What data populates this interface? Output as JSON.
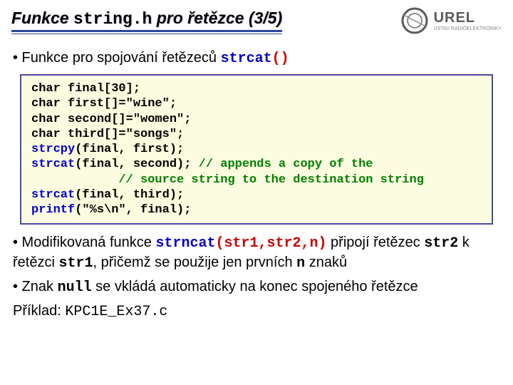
{
  "header": {
    "title_pre": "Funkce ",
    "title_mono": "string.h",
    "title_post": " pro řetězce (3/5)",
    "logo_main": "UREL",
    "logo_sub": "ÚSTAV RADIOELEKTRONIKY"
  },
  "bullet1": {
    "pre": "• Funkce pro spojování řetězeců ",
    "fn": "strcat",
    "paren": "()"
  },
  "code": {
    "l1": "char final[30];",
    "l2": "char first[]=\"wine\";",
    "l3": "char second[]=\"women\";",
    "l4": "char third[]=\"songs\";",
    "l5a": "strcpy",
    "l5b": "(final, first);",
    "l6a": "strcat",
    "l6b": "(final, second); ",
    "l6c": "// appends a copy of the",
    "l7": "            // source string to the destination string",
    "l8a": "strcat",
    "l8b": "(final, third);",
    "l9a": "printf",
    "l9b": "(\"%s\\n\", final);"
  },
  "bullet2": {
    "pre": "•  Modifikovaná funkce ",
    "fn": "strncat",
    "args": "(str1,str2,n)",
    "mid1": "  připojí řetězec ",
    "s2": "str2",
    "mid2": "  k řetězci ",
    "s1": "str1",
    "mid3": ", přičemž se použije jen prvních ",
    "n": "n",
    "tail": "  znaků"
  },
  "bullet3": {
    "pre": "• Znak ",
    "null": "null",
    "tail": "  se vkládá automaticky na konec spojeného řetězce"
  },
  "example": {
    "label": "Příklad: ",
    "file": "KPC1E_Ex37.c"
  }
}
